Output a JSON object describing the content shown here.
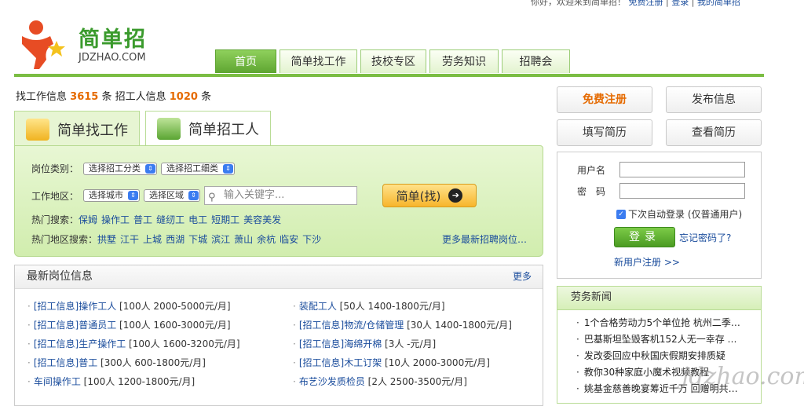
{
  "topbar": {
    "welcome": "你好，欢迎来到简单招！",
    "register": "免费注册",
    "sep": "|",
    "login": "登录",
    "my": "我的简单招"
  },
  "logo": {
    "brand": "简单招",
    "domain": "JDZHAO.COM"
  },
  "nav": [
    {
      "label": "首页",
      "active": true
    },
    {
      "label": "简单找工作",
      "active": false
    },
    {
      "label": "技校专区",
      "active": false
    },
    {
      "label": "劳务知识",
      "active": false
    },
    {
      "label": "招聘会",
      "active": false
    }
  ],
  "stats": {
    "prefix": "找工作信息",
    "job_count": "3615",
    "mid": "条 招工人信息",
    "worker_count": "1020",
    "suffix": "条"
  },
  "search_tabs": {
    "find_job": "简单找工作",
    "find_worker": "简单招工人"
  },
  "search": {
    "category_label": "岗位类别：",
    "category_select": "选择招工分类",
    "subcategory_select": "选择招工细类",
    "area_label": "工作地区：",
    "city_select": "选择城市",
    "district_select": "选择区域",
    "keyword_placeholder": "输入关键字...",
    "search_button": "简单(找)",
    "hot_label": "热门搜索：",
    "hot_terms": [
      "保姆",
      "操作工",
      "普工",
      "缝纫工",
      "电工",
      "短期工",
      "美容美发"
    ],
    "hot_area_label": "热门地区搜索：",
    "hot_areas": [
      "拱墅",
      "江干",
      "上城",
      "西湖",
      "下城",
      "滨江",
      "萧山",
      "余杭",
      "临安",
      "下沙"
    ],
    "more_link": "更多最新招聘岗位…"
  },
  "jobs": {
    "title": "最新岗位信息",
    "more": "更多",
    "left": [
      {
        "title": "[招工信息]操作工人",
        "meta": "[100人 2000-5000元/月]"
      },
      {
        "title": "[招工信息]普通员工",
        "meta": "[100人 1600-3000元/月]"
      },
      {
        "title": "[招工信息]生产操作工",
        "meta": "[100人 1600-3200元/月]"
      },
      {
        "title": "[招工信息]普工",
        "meta": "[300人 600-1800元/月]"
      },
      {
        "title": "车间操作工",
        "meta": "[100人 1200-1800元/月]"
      }
    ],
    "right": [
      {
        "title": "装配工人",
        "meta": "[50人 1400-1800元/月]"
      },
      {
        "title": "[招工信息]物流/仓储管理",
        "meta": "[30人 1400-1800元/月]"
      },
      {
        "title": "[招工信息]海绵开棉",
        "meta": "[3人 -元/月]"
      },
      {
        "title": "[招工信息]木工订架",
        "meta": "[10人 2000-3000元/月]"
      },
      {
        "title": "布艺沙发质检员",
        "meta": "[2人 2500-3500元/月]"
      }
    ]
  },
  "right_buttons": {
    "register": "免费注册",
    "post": "发布信息",
    "resume_fill": "填写简历",
    "resume_view": "查看简历"
  },
  "login": {
    "username_label": "用户名",
    "password_label": "密　码",
    "remember": "下次自动登录 (仅普通用户)",
    "login_button": "登录",
    "forgot": "忘记密码了?",
    "new_user": "新用户注册 >>"
  },
  "news": {
    "title": "劳务新闻",
    "items": [
      "1个合格劳动力5个单位抢 杭州二季…",
      "巴基斯坦坠毁客机152人无一幸存 …",
      "发改委回应中秋国庆假期安排质疑",
      "教你30种家庭小魔术视频教程",
      "姚基金慈善晚宴筹近千万 回赠明共…"
    ]
  },
  "watermark": "jdzhao.com",
  "colors": {
    "brand_green": "#3a9a2c",
    "accent_orange": "#e56a00",
    "link_blue": "#1a4c9c"
  }
}
